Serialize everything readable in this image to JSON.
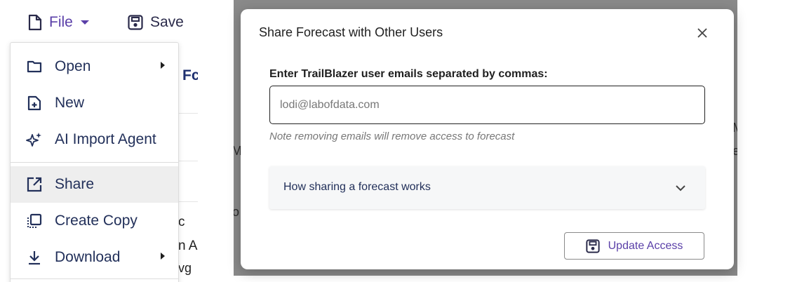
{
  "toolbar": {
    "file_label": "File",
    "save_label": "Save"
  },
  "background_fragments": {
    "fc": "Fc",
    "c": "c",
    "na": "n A",
    "vg": "vg",
    "m": "M",
    "e": "e",
    "o": "o"
  },
  "file_menu": {
    "items": [
      {
        "label": "Open",
        "icon": "folder-icon",
        "has_submenu": true
      },
      {
        "label": "New",
        "icon": "new-file-icon",
        "has_submenu": false
      },
      {
        "label": "AI Import Agent",
        "icon": "sparkles-icon",
        "has_submenu": false
      },
      {
        "label": "Share",
        "icon": "share-icon",
        "has_submenu": false,
        "active": true
      },
      {
        "label": "Create Copy",
        "icon": "copy-icon",
        "has_submenu": false
      },
      {
        "label": "Download",
        "icon": "download-icon",
        "has_submenu": true
      }
    ]
  },
  "share_dialog": {
    "title": "Share Forecast with Other Users",
    "field_label": "Enter TrailBlazer user emails separated by commas:",
    "email_value": "",
    "email_placeholder": "lodi@labofdata.com",
    "helper_text": "Note removing emails will remove access to forecast",
    "accordion_label": "How sharing a forecast works",
    "update_button_label": "Update Access"
  },
  "colors": {
    "accent_purple": "#5a3fa8",
    "navy_text": "#22305a",
    "backdrop": "#8a8a8a",
    "active_menu_bg": "#eeeeee"
  }
}
